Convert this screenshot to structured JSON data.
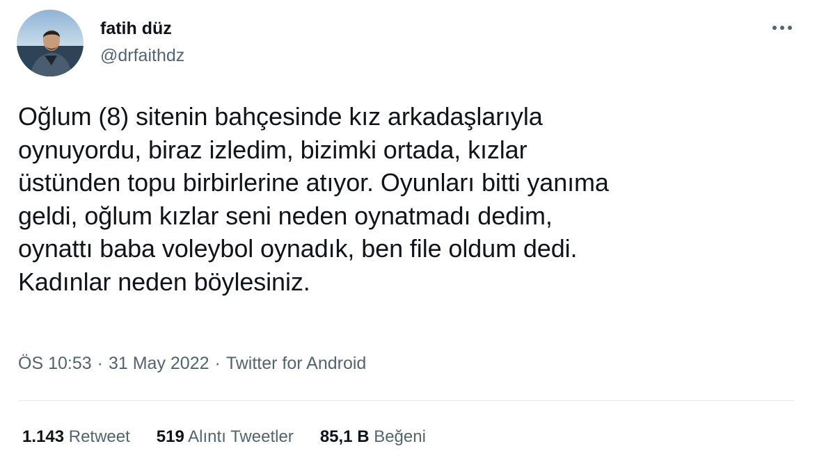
{
  "author": {
    "display_name": "fatih düz",
    "handle": "@drfaithdz"
  },
  "tweet": {
    "text": "Oğlum (8) sitenin bahçesinde kız arkadaşlarıyla\noynuyordu, biraz izledim, bizimki ortada, kızlar\nüstünden topu birbirlerine atıyor. Oyunları bitti yanıma\ngeldi, oğlum kızlar seni neden oynatmadı dedim,\noynattı baba voleybol oynadık, ben file oldum dedi.\nKadınlar neden böylesiniz."
  },
  "meta": {
    "time": "ÖS 10:53",
    "date": "31 May 2022",
    "source": "Twitter for Android",
    "separator": "·"
  },
  "stats": {
    "retweets": {
      "count": "1.143",
      "label": "Retweet"
    },
    "quotes": {
      "count": "519",
      "label": "Alıntı Tweetler"
    },
    "likes": {
      "count": "85,1 B",
      "label": "Beğeni"
    }
  },
  "icons": {
    "more": "more-horizontal-icon"
  },
  "colors": {
    "text": "#0f1419",
    "secondary": "#536471",
    "divider": "#e6ecf0"
  }
}
